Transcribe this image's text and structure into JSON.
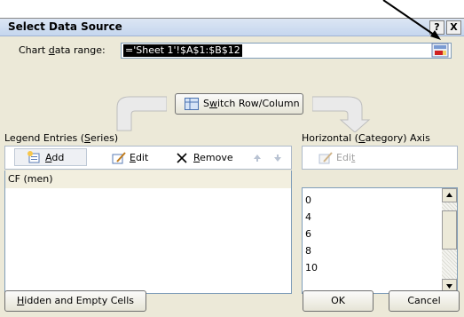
{
  "window": {
    "title": "Select Data Source",
    "help_button": "?",
    "close_button": "X"
  },
  "chart_range": {
    "label_pre": "Chart ",
    "label_key": "d",
    "label_post": "ata range:",
    "value": "='Sheet 1'!$A$1:$B$12"
  },
  "switch_button": {
    "label_pre": "S",
    "label_key": "w",
    "label_post": "itch Row/Column"
  },
  "legend": {
    "heading_pre": "Legend Entries (",
    "heading_key": "S",
    "heading_post": "eries)",
    "add_key": "A",
    "add_rest": "dd",
    "edit_key": "E",
    "edit_rest": "dit",
    "remove_key": "R",
    "remove_rest": "emove",
    "entries": [
      "CF (men)"
    ]
  },
  "axis": {
    "heading_pre": "Horizontal (",
    "heading_key": "C",
    "heading_post": "ategory) Axis Labels",
    "edit_pre": "Edi",
    "edit_key": "t",
    "labels": [
      "0",
      "4",
      "6",
      "8",
      "10"
    ]
  },
  "footer": {
    "hidden_key": "H",
    "hidden_rest": "idden and Empty Cells",
    "ok": "OK",
    "cancel": "Cancel"
  },
  "colors": {
    "selected_row": "#f2efdf",
    "titlebar": "#c5d6ee",
    "dialog": "#ece9d8"
  }
}
